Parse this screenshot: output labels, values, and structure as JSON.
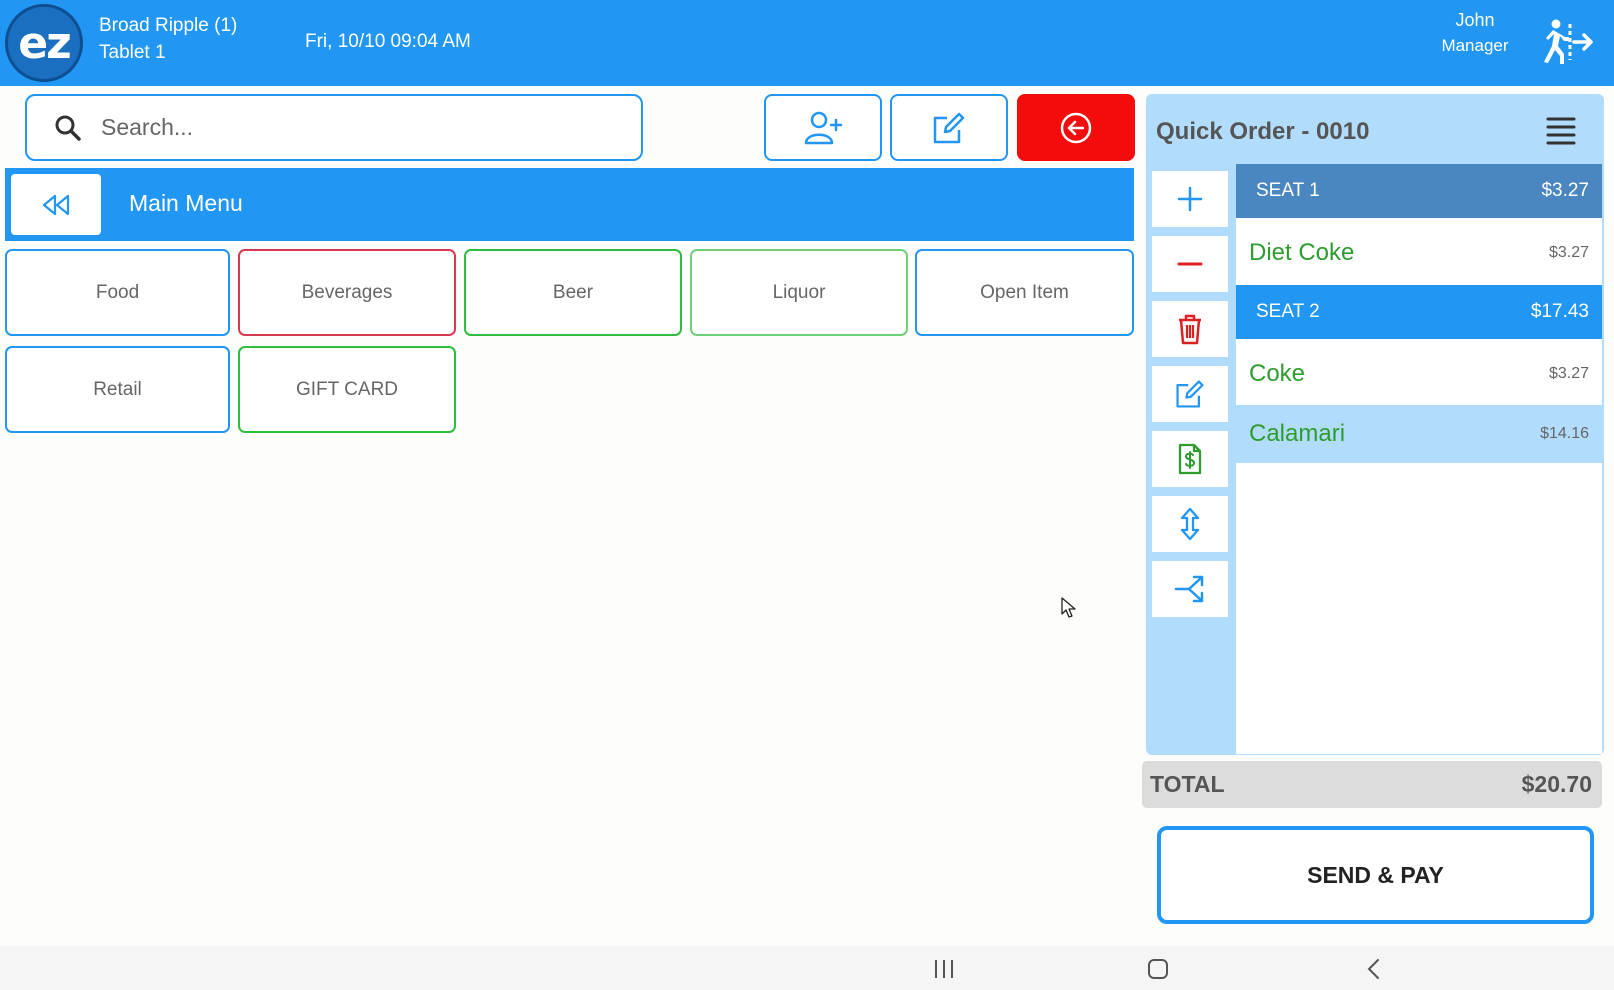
{
  "header": {
    "store_name": "Broad Ripple (1)",
    "device": "Tablet 1",
    "datetime": "Fri, 10/10 09:04 AM",
    "user_name": "John",
    "user_role": "Manager",
    "logo_text": "ez"
  },
  "search": {
    "placeholder": "Search..."
  },
  "menu": {
    "title": "Main Menu",
    "categories": [
      {
        "label": "Food",
        "color": "#2196f3"
      },
      {
        "label": "Beverages",
        "color": "#d83a52"
      },
      {
        "label": "Beer",
        "color": "#2ebd3e"
      },
      {
        "label": "Liquor",
        "color": "#6fd07a"
      },
      {
        "label": "Open Item",
        "color": "#2196f3"
      },
      {
        "label": "Retail",
        "color": "#2196f3"
      },
      {
        "label": "GIFT CARD",
        "color": "#2ebd3e"
      }
    ]
  },
  "order": {
    "title": "Quick Order - 0010",
    "seats": [
      {
        "label": "SEAT 1",
        "total": "$3.27",
        "color": "#4a86c0"
      },
      {
        "label": "SEAT 2",
        "total": "$17.43",
        "color": "#2196f3"
      }
    ],
    "items": [
      {
        "name": "Diet Coke",
        "price": "$3.27"
      },
      {
        "name": "Coke",
        "price": "$3.27"
      },
      {
        "name": "Calamari",
        "price": "$14.16"
      }
    ],
    "total_label": "TOTAL",
    "total_value": "$20.70",
    "send_pay_label": "SEND & PAY"
  },
  "colors": {
    "primary": "#2196f3",
    "danger": "#f40b0b",
    "item_green": "#2e9c2e",
    "panel_bg": "#b2dcfb"
  }
}
